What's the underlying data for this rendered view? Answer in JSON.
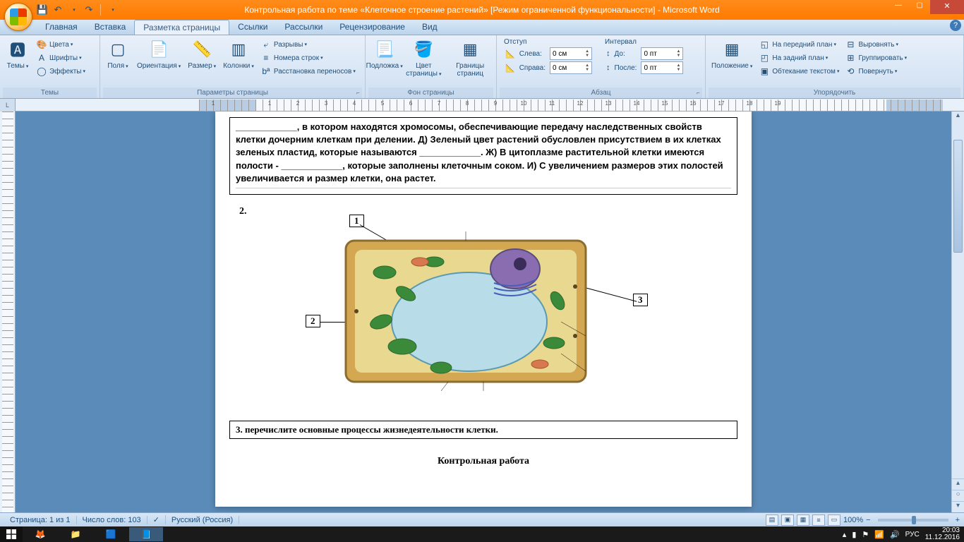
{
  "title": "Контрольная работа по теме «Клеточное строение растений» [Режим ограниченной функциональности] - Microsoft Word",
  "tabs": {
    "home": "Главная",
    "insert": "Вставка",
    "layout": "Разметка страницы",
    "refs": "Ссылки",
    "mail": "Рассылки",
    "review": "Рецензирование",
    "view": "Вид"
  },
  "ribbon": {
    "themes": {
      "title": "Темы",
      "themes_btn": "Темы",
      "colors": "Цвета",
      "fonts": "Шрифты",
      "effects": "Эффекты"
    },
    "pagesetup": {
      "title": "Параметры страницы",
      "margins": "Поля",
      "orientation": "Ориентация",
      "size": "Размер",
      "columns": "Колонки",
      "breaks": "Разрывы",
      "linenumbers": "Номера строк",
      "hyphenation": "Расстановка переносов"
    },
    "pagebg": {
      "title": "Фон страницы",
      "watermark": "Подложка",
      "pagecolor": "Цвет страницы",
      "borders": "Границы страниц"
    },
    "paragraph": {
      "title": "Абзац",
      "indent": "Отступ",
      "spacing": "Интервал",
      "left": "Слева:",
      "right": "Справа:",
      "before": "До:",
      "after": "После:",
      "left_val": "0 см",
      "right_val": "0 см",
      "before_val": "0 пт",
      "after_val": "0 пт"
    },
    "arrange": {
      "title": "Упорядочить",
      "position": "Положение",
      "front": "На передний план",
      "back": "На задний план",
      "wrap": "Обтекание текстом",
      "align": "Выровнять",
      "group": "Группировать",
      "rotate": "Повернуть"
    }
  },
  "document": {
    "para1": "____________, в котором находятся хромосомы, обеспечивающие передачу наследственных свойств клетки дочерним клеткам при делении. Д) Зеленый цвет растений обусловлен присутствием в их клетках зеленых пластид, которые называются ____________. Ж) В цитоплазме растительной клетки имеются полости - ____________, которые заполнены клеточным соком. И) С увеличением размеров этих полостей увеличивается и размер клетки, она растет.",
    "q2": "2.",
    "label1": "1",
    "label2": "2",
    "label3": "3",
    "q3": "3.  перечислите основные процессы жизнедеятельности клетки.",
    "heading": "Контрольная работа"
  },
  "statusbar": {
    "page": "Страница: 1 из 1",
    "words": "Число слов: 103",
    "lang": "Русский (Россия)",
    "zoom": "100%"
  },
  "taskbar": {
    "lang": "РУС",
    "time": "20:03",
    "date": "11.12.2016"
  },
  "ruler_numbers": [
    "1",
    "",
    "1",
    "2",
    "3",
    "4",
    "5",
    "6",
    "7",
    "8",
    "9",
    "10",
    "11",
    "12",
    "13",
    "14",
    "15",
    "16",
    "17",
    "18",
    "19"
  ]
}
